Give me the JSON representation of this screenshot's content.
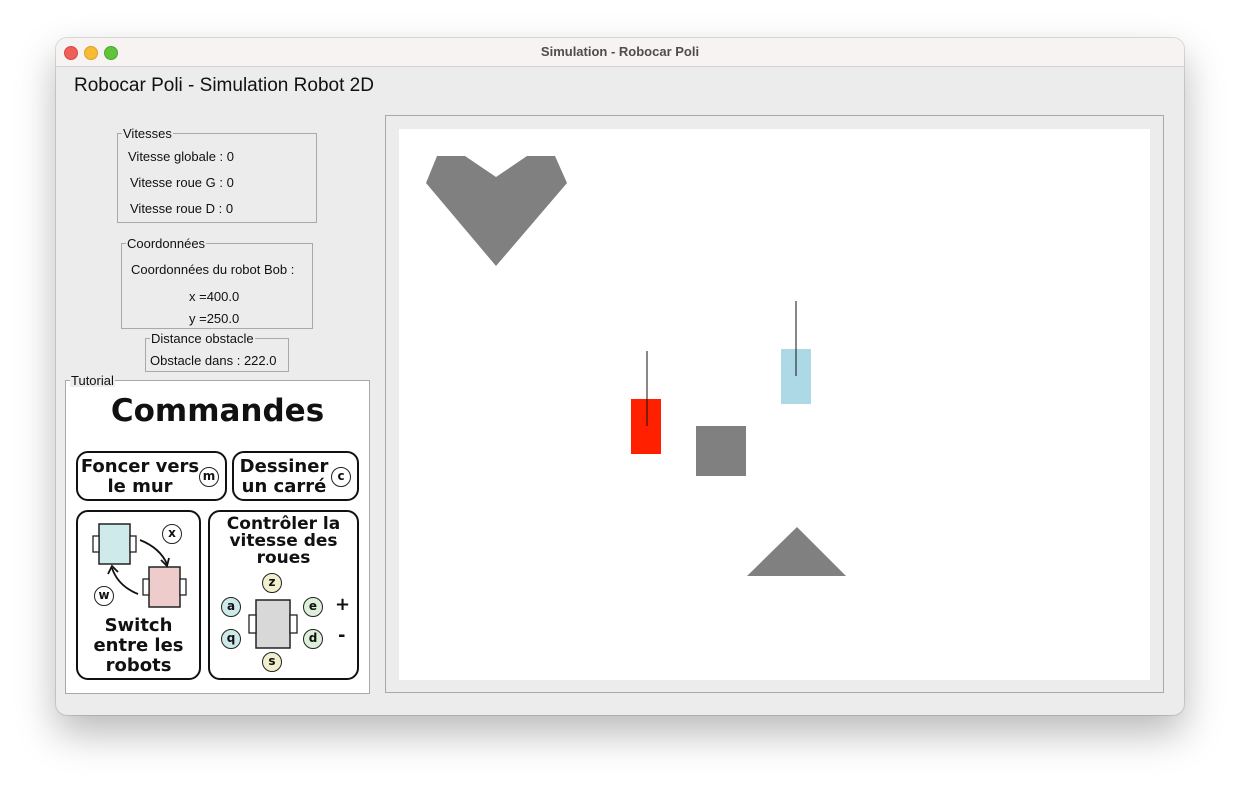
{
  "window": {
    "title": "Simulation - Robocar Poli",
    "app_title": "Robocar Poli - Simulation Robot 2D"
  },
  "speeds": {
    "legend": "Vitesses",
    "global": "Vitesse globale : 0",
    "left_wheel": "Vitesse roue G : 0",
    "right_wheel": "Vitesse roue D : 0"
  },
  "coords": {
    "legend": "Coordonnées",
    "robot_label": "Coordonnées du robot Bob :",
    "x": "x =400.0",
    "y": "y =250.0"
  },
  "obstacle": {
    "legend": "Distance obstacle",
    "text": "Obstacle dans : 222.0"
  },
  "tutorial": {
    "legend": "Tutorial",
    "heading": "Commandes",
    "wall_line1": "Foncer vers",
    "wall_line2": "le mur",
    "wall_key": "m",
    "square_line1": "Dessiner",
    "square_line2": "un carré",
    "square_key": "c",
    "switch_line1": "Switch",
    "switch_line2": "entre les",
    "switch_line3": "robots",
    "switch_key_x": "x",
    "switch_key_w": "w",
    "speed_line1": "Contrôler la",
    "speed_line2": "vitesse des",
    "speed_line3": "roues",
    "keys": {
      "z": "z",
      "a": "a",
      "q": "q",
      "e": "e",
      "d": "d",
      "s": "s"
    },
    "plus": "+",
    "minus": "-"
  },
  "colors": {
    "robot_red": "#ff2000",
    "robot_blue": "#add8e6",
    "obstacle_gray": "#808080",
    "key_blue": "#cde9e9",
    "key_yellow": "#f2efcf",
    "key_green": "#dcefd8",
    "tut_robot_blue": "#cfeaea",
    "tut_robot_pink": "#efcccc"
  }
}
